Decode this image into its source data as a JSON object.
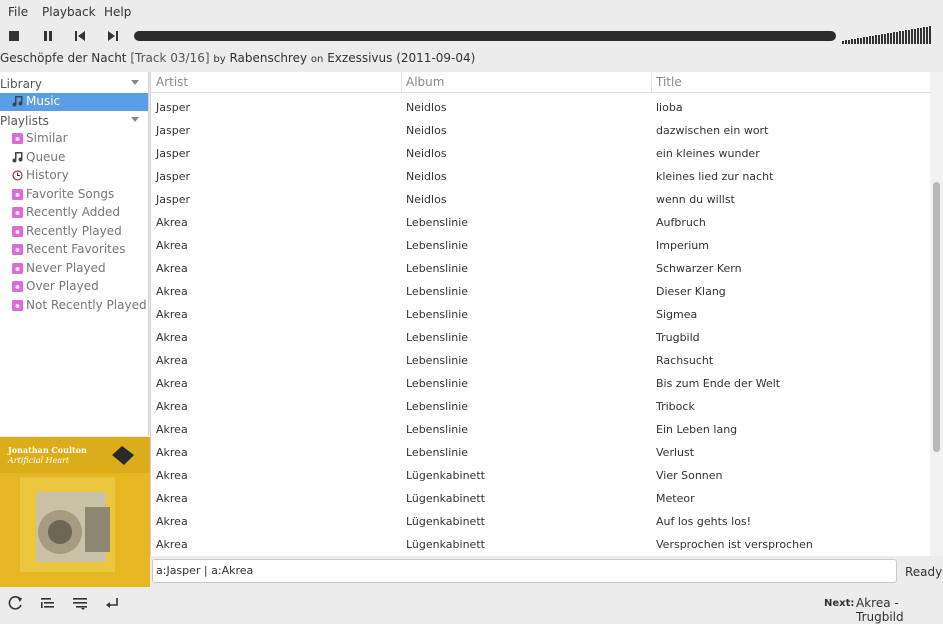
{
  "menu": [
    "File",
    "Playback",
    "Help"
  ],
  "toolbar": {
    "stop_icon": "stop-icon",
    "pause_icon": "pause-icon",
    "prev_icon": "previous-icon",
    "next_icon": "next-icon",
    "progress_fraction": 0.0,
    "volume_fraction": 1.0
  },
  "now_playing": {
    "title": "Geschöpfe der Nacht",
    "track": "[Track 03/16]",
    "by": "by",
    "artist": "Rabenschrey",
    "on": "on",
    "album": "Exzessivus",
    "date": "(2011-09-04)"
  },
  "sidebar": {
    "library_label": "Library",
    "library_items": [
      {
        "label": "Music",
        "icon": "music-note-icon",
        "selected": true
      }
    ],
    "playlists_label": "Playlists",
    "playlist_items": [
      {
        "label": "Similar",
        "icon": "playlist-icon"
      },
      {
        "label": "Queue",
        "icon": "music-note-icon"
      },
      {
        "label": "History",
        "icon": "history-icon"
      },
      {
        "label": "Favorite Songs",
        "icon": "playlist-icon"
      },
      {
        "label": "Recently Added",
        "icon": "playlist-icon"
      },
      {
        "label": "Recently Played",
        "icon": "playlist-icon"
      },
      {
        "label": "Recent Favorites",
        "icon": "playlist-icon"
      },
      {
        "label": "Never Played",
        "icon": "playlist-icon"
      },
      {
        "label": "Over Played",
        "icon": "playlist-icon"
      },
      {
        "label": "Not Recently Played",
        "icon": "playlist-icon"
      }
    ]
  },
  "album_art": {
    "artist": "Jonathan Coulton",
    "album": "Artificial Heart",
    "color": "#e6b720"
  },
  "tracklist": {
    "columns": [
      "Artist",
      "Album",
      "Title"
    ],
    "rows": [
      [
        "Jasper",
        "Neidlos",
        "lioba"
      ],
      [
        "Jasper",
        "Neidlos",
        "dazwischen ein wort"
      ],
      [
        "Jasper",
        "Neidlos",
        "ein kleines wunder"
      ],
      [
        "Jasper",
        "Neidlos",
        "kleines lied zur nacht"
      ],
      [
        "Jasper",
        "Neidlos",
        "wenn du willst"
      ],
      [
        "Akrea",
        "Lebenslinie",
        "Aufbruch"
      ],
      [
        "Akrea",
        "Lebenslinie",
        "Imperium"
      ],
      [
        "Akrea",
        "Lebenslinie",
        "Schwarzer Kern"
      ],
      [
        "Akrea",
        "Lebenslinie",
        "Dieser Klang"
      ],
      [
        "Akrea",
        "Lebenslinie",
        "Sigmea"
      ],
      [
        "Akrea",
        "Lebenslinie",
        "Trugbild"
      ],
      [
        "Akrea",
        "Lebenslinie",
        "Rachsucht"
      ],
      [
        "Akrea",
        "Lebenslinie",
        "Bis zum Ende der Welt"
      ],
      [
        "Akrea",
        "Lebenslinie",
        "Tribock"
      ],
      [
        "Akrea",
        "Lebenslinie",
        "Ein Leben lang"
      ],
      [
        "Akrea",
        "Lebenslinie",
        "Verlust"
      ],
      [
        "Akrea",
        "Lügenkabinett",
        "Vier Sonnen"
      ],
      [
        "Akrea",
        "Lügenkabinett",
        "Meteor"
      ],
      [
        "Akrea",
        "Lügenkabinett",
        "Auf los gehts los!"
      ],
      [
        "Akrea",
        "Lügenkabinett",
        "Versprochen ist versprochen"
      ]
    ]
  },
  "filter": {
    "value": "a:Jasper | a:Akrea"
  },
  "status": {
    "text": "Ready"
  },
  "bottom": {
    "buttons": [
      "repeat-icon",
      "shuffle-icon",
      "queue-icon",
      "stop-after-icon"
    ],
    "next_label": "Next:",
    "next_track": "Akrea - Trugbild"
  }
}
